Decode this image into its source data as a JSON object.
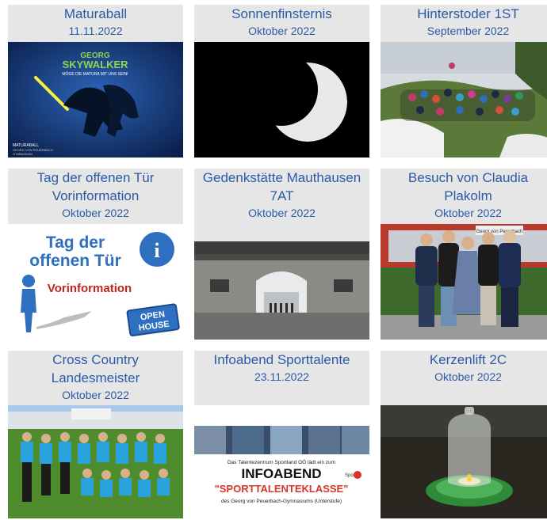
{
  "cards": [
    {
      "title": "Maturaball",
      "date": "11.11.2022",
      "image_desc": "matura-ball-poster-icon"
    },
    {
      "title": "Sonnenfinsternis",
      "date": "Oktober 2022",
      "image_desc": "solar-eclipse-photo-icon"
    },
    {
      "title": "Hinterstoder 1ST",
      "date": "September 2022",
      "image_desc": "group-photo-icon"
    },
    {
      "title": "Tag der offenen Tür\nVorinformation",
      "date": "Oktober 2022",
      "image_desc": "open-house-info-icon"
    },
    {
      "title": "Gedenkstätte Mauthausen\n7AT",
      "date": "Oktober 2022",
      "image_desc": "memorial-gate-photo-icon"
    },
    {
      "title": "Besuch von Claudia\nPlakolm",
      "date": "Oktober 2022",
      "image_desc": "visitors-photo-icon"
    },
    {
      "title": "Cross Country\nLandesmeister",
      "date": "Oktober 2022",
      "image_desc": "team-photo-icon"
    },
    {
      "title": "Infoabend Sporttalente",
      "date": "23.11.2022",
      "image_desc": "info-evening-flyer-icon"
    },
    {
      "title": "Kerzenlift 2C",
      "date": "Oktober 2022",
      "image_desc": "candle-photo-icon"
    }
  ],
  "thumb_text": {
    "maturaball": {
      "line1": "GEORG",
      "line2": "SKYWALKER",
      "tagline": "MÖGE DIE MATURA MIT UNS SEIN!",
      "footer1": "MATURABALL",
      "footer2": "GEORG VON PEUERBACH",
      "footer3": "GYMNASIUM"
    },
    "open_house": {
      "heading1": "Tag der",
      "heading2": "offenen Tür",
      "sub": "Vorinformation",
      "sign1": "OPEN",
      "sign2": "HOUSE",
      "info": "i"
    },
    "mauthausen": {
      "gate_sign": ""
    },
    "plakolm": {
      "banner": "Georg von Peuerbach"
    },
    "infoabend": {
      "intro": "Das Talentezentrum Sportland OÖ lädt ein zum",
      "heading": "INFOABEND",
      "sport": "Sport",
      "sub": "\"SPORTTALENTEKLASSE\"",
      "footer": "des Georg von Peuerbach-Gymnasiums (Unterstufe)"
    }
  },
  "colors": {
    "link_blue": "#2b5aa7",
    "card_bg": "#e6e6e6"
  }
}
